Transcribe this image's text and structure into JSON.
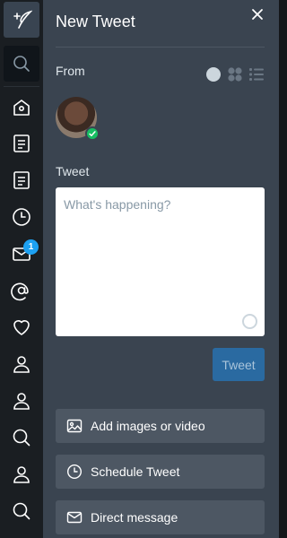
{
  "panel": {
    "title": "New Tweet",
    "from_label": "From",
    "tweet_label": "Tweet",
    "composer_placeholder": "What's happening?",
    "tweet_button": "Tweet",
    "actions": [
      {
        "label": "Add images or video",
        "icon": "image-icon"
      },
      {
        "label": "Schedule Tweet",
        "icon": "clock-icon"
      },
      {
        "label": "Direct message",
        "icon": "envelope-icon"
      }
    ]
  },
  "rail": {
    "items": [
      {
        "icon": "compose-icon"
      },
      {
        "icon": "search-icon"
      },
      {
        "icon": "home-icon"
      },
      {
        "icon": "column-icon"
      },
      {
        "icon": "column-icon"
      },
      {
        "icon": "clock-icon"
      },
      {
        "icon": "envelope-icon",
        "badge": "1"
      },
      {
        "icon": "mention-icon"
      },
      {
        "icon": "heart-icon"
      },
      {
        "icon": "user-icon"
      },
      {
        "icon": "user-icon"
      },
      {
        "icon": "search-icon"
      },
      {
        "icon": "user-icon"
      },
      {
        "icon": "search-icon"
      }
    ]
  },
  "colors": {
    "rail_bg": "#1a1e22",
    "panel_bg": "#3a4450",
    "button_bg": "#4d5763",
    "tweet_button_bg": "#2a6aa1",
    "badge": "#1da1f2",
    "verified": "#17bf63"
  }
}
